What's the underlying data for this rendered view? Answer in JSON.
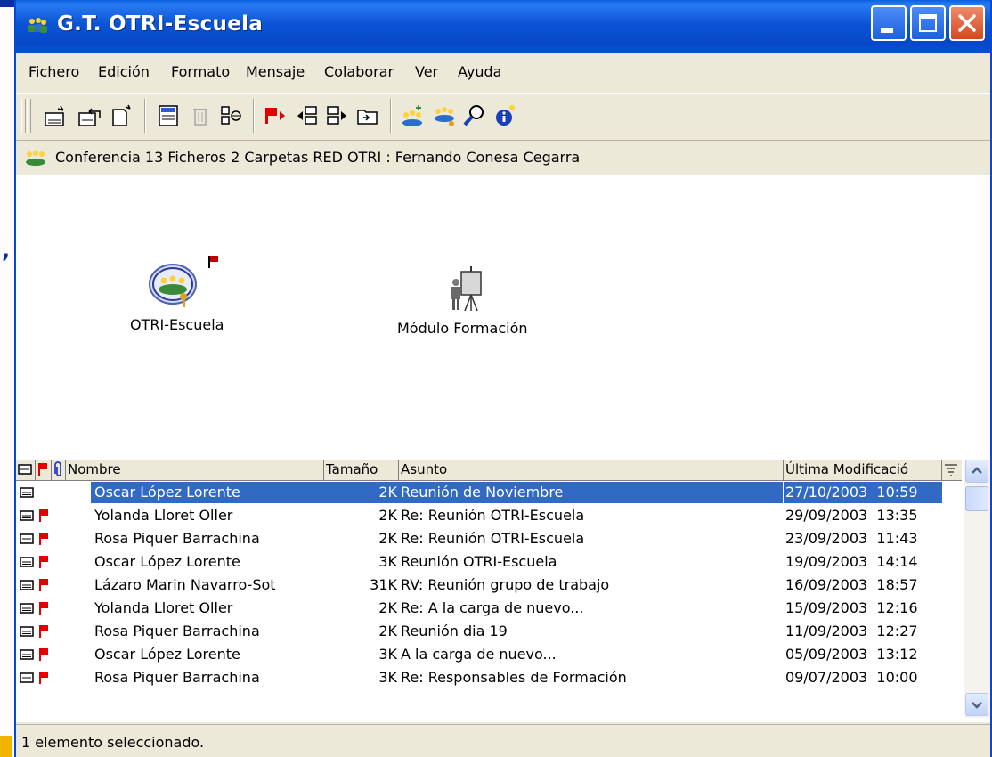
{
  "window": {
    "title": "G.T. OTRI-Escuela"
  },
  "menu": [
    "Fichero",
    "Edición",
    "Formato",
    "Mensaje",
    "Colaborar",
    "Ver",
    "Ayuda"
  ],
  "toolbar_icons": [
    "new-message-icon",
    "reply-icon",
    "new-document-icon",
    "properties-icon",
    "delete-icon",
    "view-icon",
    "flag-next-icon",
    "previous-icon",
    "next-icon",
    "folder-icon",
    "new-conference-icon",
    "members-icon",
    "search-icon",
    "info-icon"
  ],
  "info": "Conferencia  13 Ficheros  2 Carpetas   RED OTRI : Fernando Conesa Cegarra",
  "folders": [
    {
      "label": "OTRI-Escuela",
      "icon": "conference-folder-icon"
    },
    {
      "label": "Módulo Formación",
      "icon": "presentation-icon"
    }
  ],
  "list": {
    "columns": [
      "Nombre",
      "Tamaño",
      "Asunto",
      "Última Modificació"
    ],
    "rows": [
      {
        "nombre": "Oscar López Lorente",
        "tamano": "2K",
        "asunto": "Reunión de Noviembre",
        "fecha": "27/10/2003  10:59",
        "flag": false,
        "selected": true
      },
      {
        "nombre": "Yolanda Lloret Oller",
        "tamano": "2K",
        "asunto": "Re: Reunión OTRI-Escuela",
        "fecha": "29/09/2003  13:35",
        "flag": true,
        "selected": false
      },
      {
        "nombre": "Rosa Piquer Barrachina",
        "tamano": "2K",
        "asunto": "Re: Reunión OTRI-Escuela",
        "fecha": "23/09/2003  11:43",
        "flag": true,
        "selected": false
      },
      {
        "nombre": "Oscar López Lorente",
        "tamano": "3K",
        "asunto": "Reunión OTRI-Escuela",
        "fecha": "19/09/2003  14:14",
        "flag": true,
        "selected": false
      },
      {
        "nombre": "Lázaro Marin Navarro-Sot",
        "tamano": "31K",
        "asunto": "RV: Reunión grupo de trabajo",
        "fecha": "16/09/2003  18:57",
        "flag": true,
        "selected": false
      },
      {
        "nombre": "Yolanda Lloret Oller",
        "tamano": "2K",
        "asunto": "Re: A la carga de nuevo...",
        "fecha": "15/09/2003  12:16",
        "flag": true,
        "selected": false
      },
      {
        "nombre": "Rosa Piquer Barrachina",
        "tamano": "2K",
        "asunto": "Reunión dia 19",
        "fecha": "11/09/2003  12:27",
        "flag": true,
        "selected": false
      },
      {
        "nombre": "Oscar López Lorente",
        "tamano": "3K",
        "asunto": "A la carga de nuevo...",
        "fecha": "05/09/2003  13:12",
        "flag": true,
        "selected": false
      },
      {
        "nombre": "Rosa Piquer Barrachina",
        "tamano": "3K",
        "asunto": "Re: Responsables de Formación",
        "fecha": "09/07/2003  10:00",
        "flag": true,
        "selected": false
      }
    ]
  },
  "status": "1 elemento seleccionado.",
  "colors": {
    "titlebar": "#0a53d6",
    "selection": "#316ac5",
    "flag": "#e00000",
    "chrome": "#ece9d8"
  }
}
